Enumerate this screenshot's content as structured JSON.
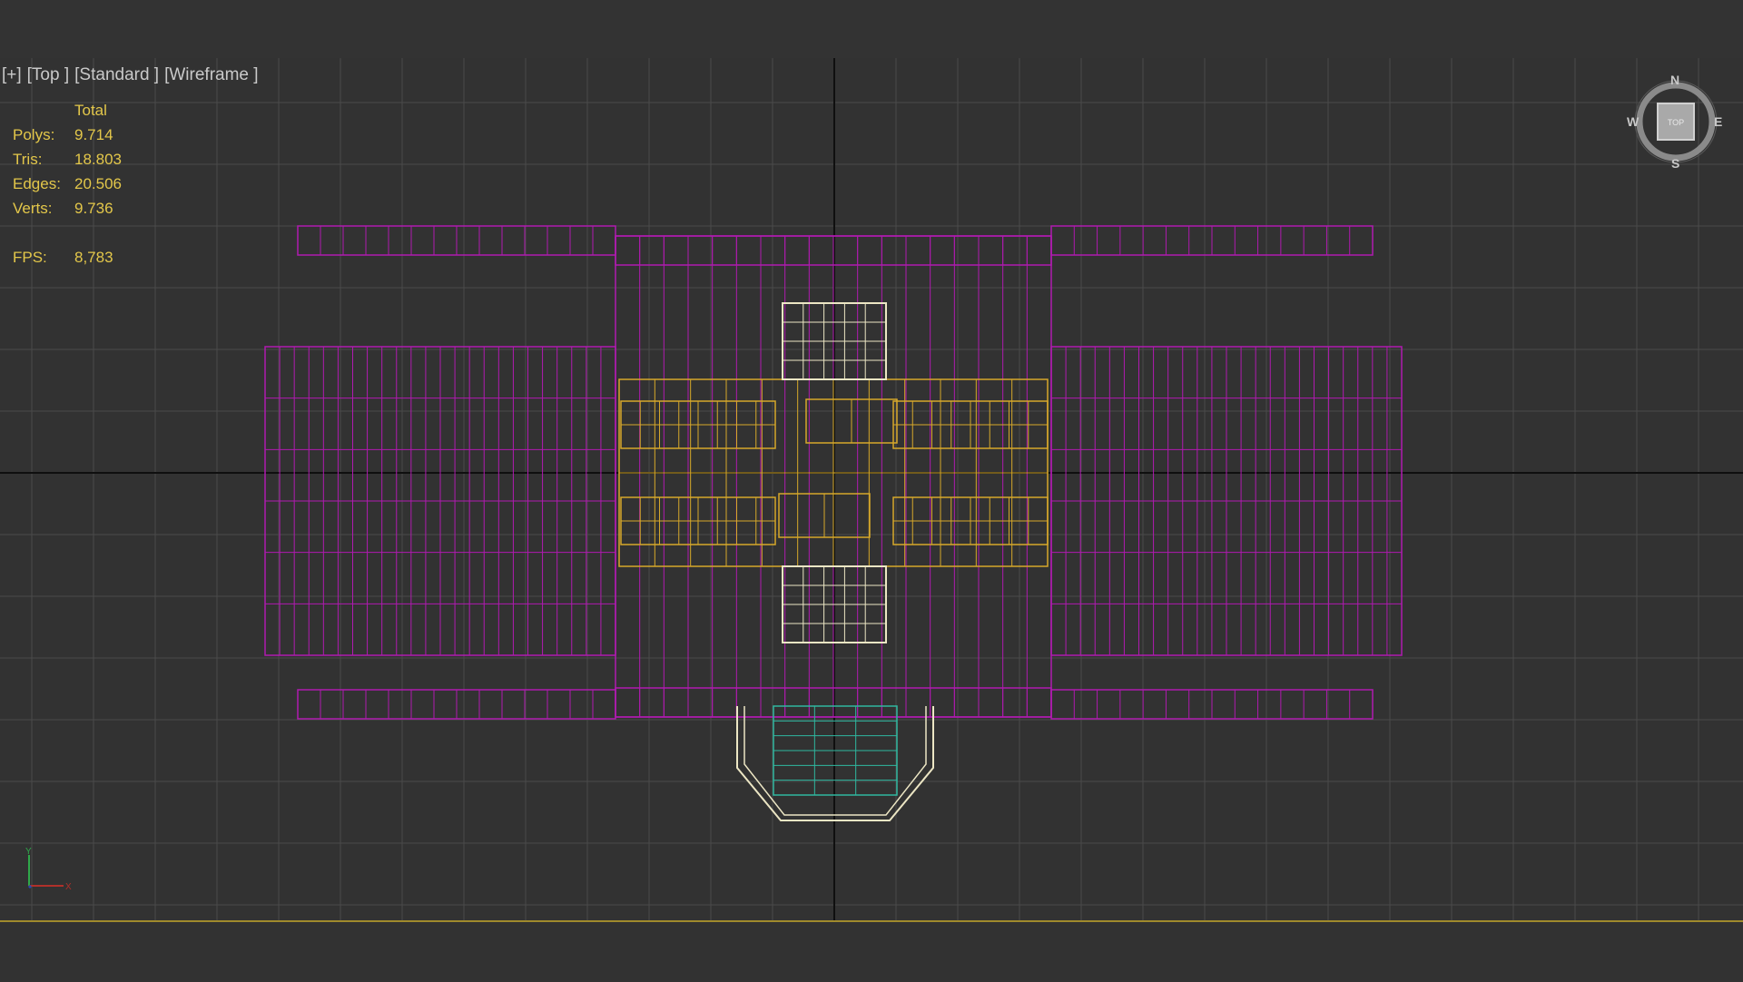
{
  "viewport_menu": {
    "plus": "[+]",
    "view": "[Top ]",
    "shading_style": "[Standard ]",
    "render_mode": "[Wireframe ]"
  },
  "stats": {
    "header": "Total",
    "polys_label": "Polys:",
    "polys_value": "9.714",
    "tris_label": "Tris:",
    "tris_value": "18.803",
    "edges_label": "Edges:",
    "edges_value": "20.506",
    "verts_label": "Verts:",
    "verts_value": "9.736",
    "fps_label": "FPS:",
    "fps_value": "8,783"
  },
  "viewcube": {
    "face_label": "TOP",
    "north": "N",
    "south": "S",
    "east": "E",
    "west": "W"
  },
  "axis_gizmo": {
    "y_label": "Y",
    "x_label": "X"
  },
  "colors": {
    "magenta_wire": "#b01ab0",
    "yellow_wire": "#d6a82a",
    "white_wire": "#ece6c4",
    "cyan_wire": "#2fb8a0",
    "grid_line": "#4a4a4a",
    "axis_line": "#0f0f0f",
    "stats_text": "#e3c74a",
    "menu_text": "#c9c9c9"
  }
}
